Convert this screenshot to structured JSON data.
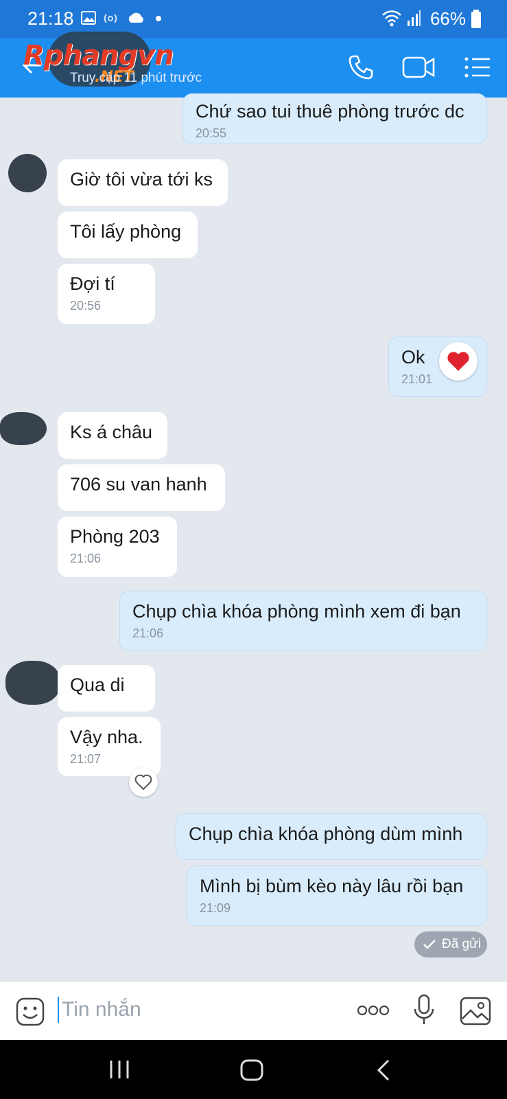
{
  "status_bar": {
    "time": "21:18",
    "battery": "66%"
  },
  "header": {
    "brand": "Rphangvn",
    "brand_suffix": ".NET",
    "subtitle": "Truy cập 11 phút trước"
  },
  "messages": [
    {
      "dir": "out",
      "text": "Chứ sao tui thuê phòng trước dc",
      "time": "20:55"
    },
    {
      "dir": "in",
      "text": "Giờ tôi vừa tới ks",
      "time": ""
    },
    {
      "dir": "in",
      "text": "Tôi lấy phòng",
      "time": ""
    },
    {
      "dir": "in",
      "text": "Đợi tí",
      "time": "20:56"
    },
    {
      "dir": "out",
      "text": "Ok",
      "time": "21:01"
    },
    {
      "dir": "in",
      "text": "Ks á châu",
      "time": ""
    },
    {
      "dir": "in",
      "text": "706 su van hanh",
      "time": ""
    },
    {
      "dir": "in",
      "text": "Phòng 203",
      "time": "21:06"
    },
    {
      "dir": "out",
      "text": "Chụp chìa khóa phòng mình xem đi bạn",
      "time": "21:06"
    },
    {
      "dir": "in",
      "text": "Qua di",
      "time": ""
    },
    {
      "dir": "in",
      "text": "Vậy nha.",
      "time": "21:07"
    },
    {
      "dir": "out",
      "text": "Chụp chìa khóa phòng dùm mình",
      "time": ""
    },
    {
      "dir": "out",
      "text": "Mình bị bùm kèo này lâu rồi bạn",
      "time": "21:09"
    }
  ],
  "sent_status": "Đã gửi",
  "composer": {
    "placeholder": "Tin nhắn"
  },
  "colors": {
    "header": "#1d8ff0",
    "status_bar": "#1f78d8",
    "incoming": "#ffffff",
    "outgoing": "#d9ecfc",
    "background": "#e3e8ef"
  }
}
